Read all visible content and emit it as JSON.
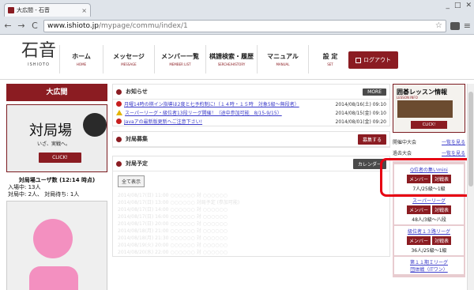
{
  "browser": {
    "tab_title": "大広間 - 石音",
    "tab_close": "×",
    "window_controls": [
      "_",
      "□",
      "✕"
    ],
    "back": "←",
    "forward": "→",
    "reload": "C",
    "url_host": "www.ishioto.jp",
    "url_path": "/mypage/commu/index/1",
    "page_num": "1",
    "star": "☆",
    "menu": "≡"
  },
  "header": {
    "logo_mark": "石音",
    "logo_sub": "ISHIOTO",
    "nav": [
      {
        "label": "ホーム",
        "sub": "HOME"
      },
      {
        "label": "メッセージ",
        "sub": "MESSAGE"
      },
      {
        "label": "メンバー一覧",
        "sub": "MEMBER LIST"
      },
      {
        "label": "棋譜検索・履歴",
        "sub": "SERCHE/HISTORY"
      },
      {
        "label": "マニュアル",
        "sub": "MANUAL"
      },
      {
        "label": "設 定",
        "sub": "SET"
      }
    ],
    "logout": "ログアウト"
  },
  "sidebar": {
    "title": "大広間",
    "banner_title": "対局場",
    "banner_sub": "いざ、実戦へ。",
    "banner_click": "CLICK!",
    "user_count_title": "対局場ユーザ数 (12:14 時点)",
    "user_count_lines": [
      "入場中: 13人",
      "対局中: 2人、 対局待ち: 1人"
    ]
  },
  "news": {
    "title": "お知らせ",
    "more": "MORE",
    "items": [
      {
        "icon": "red",
        "text": "月曜14時の棋イン指導は2度と七予約制に!（１４時・１５時　対象5級〜無段者）",
        "date": "2014/08/16(土) 09:10"
      },
      {
        "icon": "yellow",
        "text": "スーパーリーグ・級位者13段リーグ開催！（途中参加可能　8/15-9/15）",
        "date": "2014/08/15(金) 09:10"
      },
      {
        "icon": "red",
        "text": "Javaアの最新版更新へご注意下さい!",
        "date": "2014/08/01(金) 09:20"
      }
    ]
  },
  "recruit": {
    "title": "対局募集",
    "button": "募集する"
  },
  "schedule": {
    "title": "対局予定",
    "calendar_btn": "カレンダー",
    "all_btn": "全て表示",
    "rows": [
      "2014/08/17(日) 11:00 ○○○○○○ 対 ○○○○○○",
      "2014/08/17(日) 13:00 ○○○○○○ 対局予定 (参加可能)",
      "2014/08/17(日) 14:00 ○○○○○○ 対 ○○○○○○",
      "2014/08/17(日) 16:00 ○○○○○○ 対 ○○○○○○",
      "2014/08/17(日) 20:00 ○○○○○○ 対 ○○○○○○",
      "2014/08/18(月) 21:00 ○○○○○○ 対 ○○○○○○",
      "2014/08/18(月) 21:30 ○○○○○○ 対 ○○○○○○",
      "2014/08/19(火) 20:00 ○○○○○○ 対 ○○○○○○",
      "2014/08/20(水) 22:00 ○○○○○○ 対 ○○○○○○"
    ]
  },
  "right": {
    "lesson_title": "囲碁レッスン情報",
    "lesson_sub": "LESSON INFO",
    "lesson_click": "CLICK!",
    "tournaments": [
      {
        "label": "開催中大会",
        "link": "一覧を見る"
      },
      {
        "label": "過去大会",
        "link": "一覧を見る"
      }
    ],
    "leagues": [
      {
        "name": "Q位者の集いmini",
        "members_btn": "メンバー",
        "table_btn": "対戦表",
        "info": "7人/25級〜1級"
      },
      {
        "name": "スーパーリーグ",
        "members_btn": "メンバー",
        "table_btn": "対戦表",
        "info": "48人/3級〜八段"
      },
      {
        "name": "級位者１３路リーグ",
        "members_btn": "メンバー",
        "table_btn": "対戦表",
        "info": "36人/25級〜1級"
      },
      {
        "name": "第１１期Ｉリーグ",
        "members_btn": "",
        "table_btn": "",
        "info": ""
      },
      {
        "name": "団体戦（ITワン）",
        "members_btn": "",
        "table_btn": "",
        "info": ""
      }
    ]
  }
}
